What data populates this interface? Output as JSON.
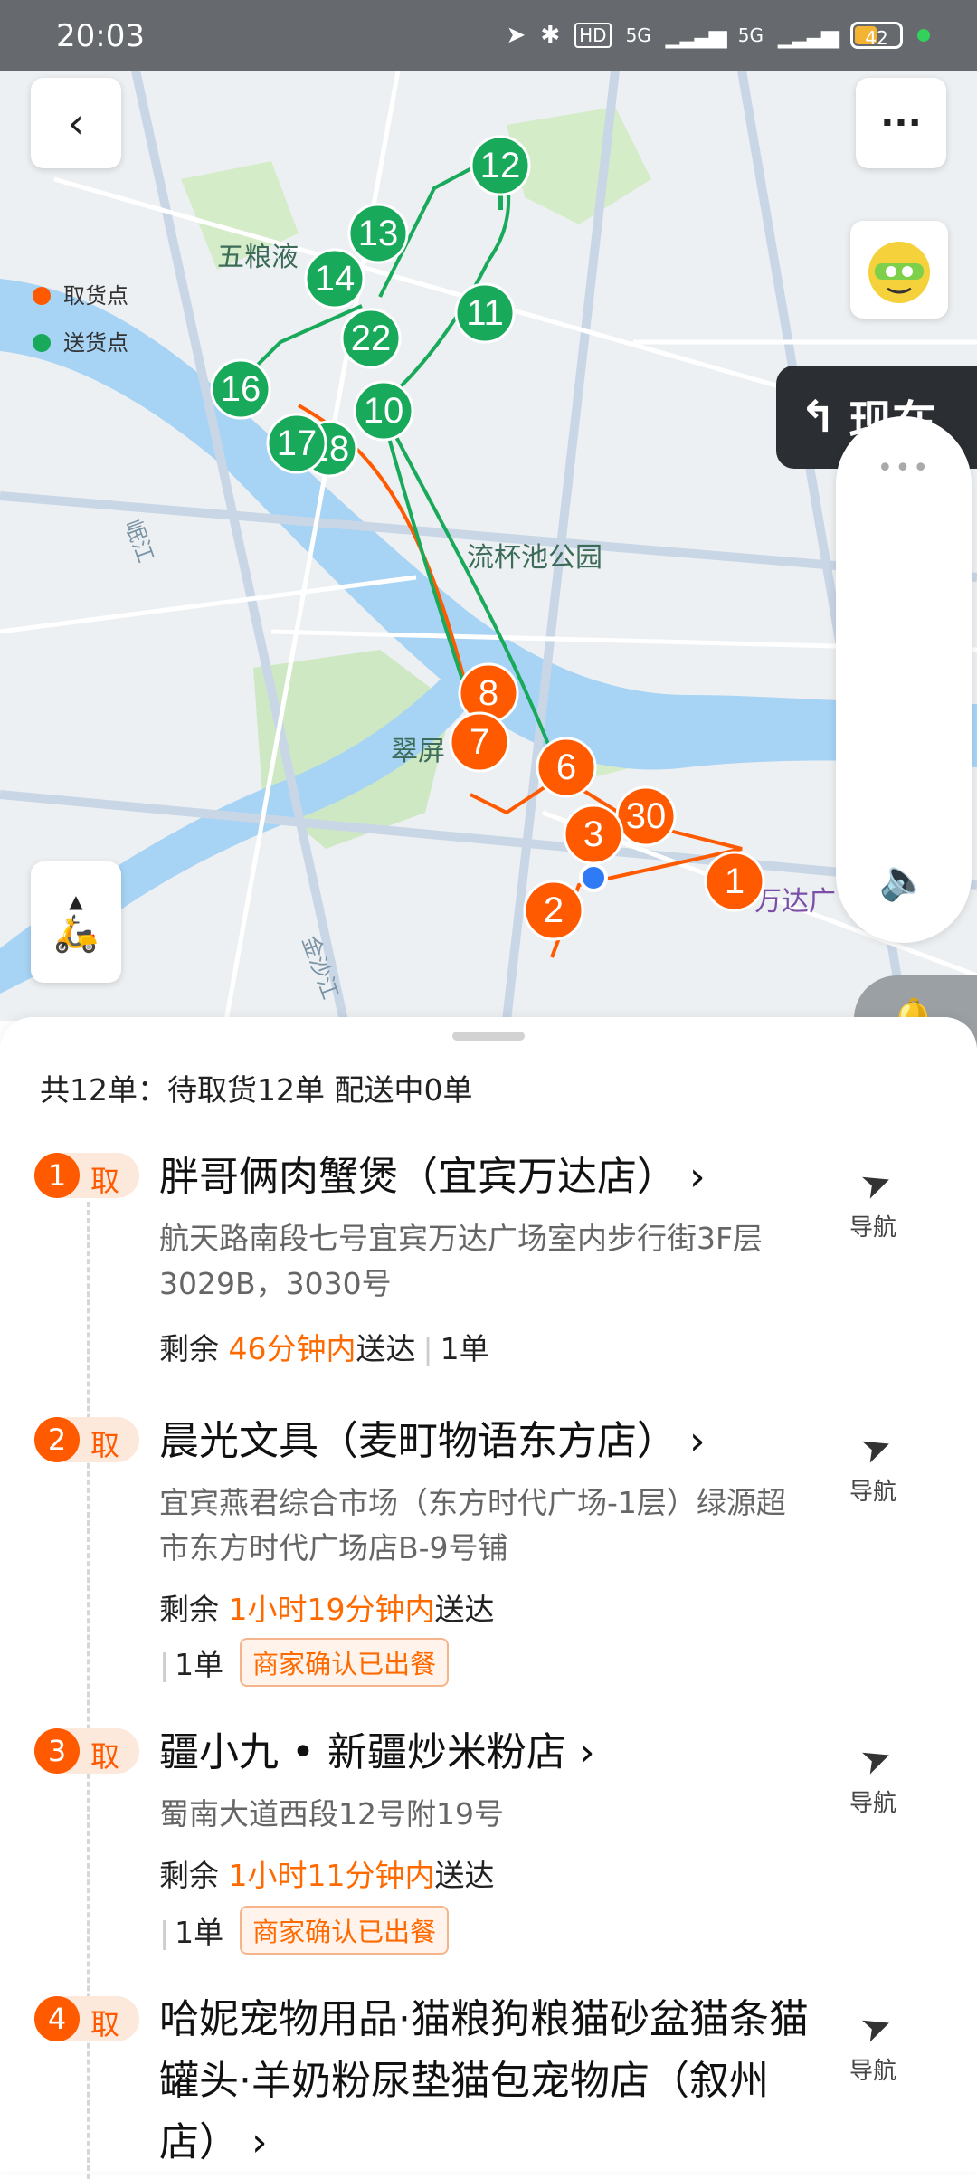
{
  "status_bar": {
    "time": "20:03",
    "network": "5G",
    "battery": "42"
  },
  "map": {
    "legend": [
      {
        "label": "取货点",
        "color": "#ff5a00"
      },
      {
        "label": "送货点",
        "color": "#19a95a"
      }
    ],
    "places": [
      "五粮液",
      "流杯池公园",
      "翠屏",
      "万达广"
    ],
    "rivers": [
      "岷江",
      "金沙江"
    ],
    "nav_banner": "现在",
    "pickup_pins": [
      "1",
      "2",
      "3",
      "6",
      "7",
      "8",
      "30"
    ],
    "delivery_pins": [
      "10",
      "11",
      "12",
      "13",
      "14",
      "16",
      "17",
      "18",
      "22"
    ]
  },
  "summary": "共12单：待取货12单 配送中0单",
  "orders": [
    {
      "index": "1",
      "kind": "取",
      "name": "胖哥俩肉蟹煲（宜宾万达店）",
      "address": "航天路南段七号宜宾万达广场室内步行街3F层3029B，3030号",
      "remain_prefix": "剩余",
      "remain_time": "46分钟内",
      "remain_suffix": "送达",
      "count": "1单",
      "tag": "",
      "nav": "导航"
    },
    {
      "index": "2",
      "kind": "取",
      "name": "晨光文具（麦町物语东方店）",
      "address": "宜宾燕君综合市场（东方时代广场-1层）绿源超市东方时代广场店B-9号铺",
      "remain_prefix": "剩余",
      "remain_time": "1小时19分钟内",
      "remain_suffix": "送达",
      "count": "1单",
      "tag": "商家确认已出餐",
      "nav": "导航"
    },
    {
      "index": "3",
      "kind": "取",
      "name": "疆小九 • 新疆炒米粉店",
      "address": "蜀南大道西段12号附19号",
      "remain_prefix": "剩余",
      "remain_time": "1小时11分钟内",
      "remain_suffix": "送达",
      "count": "1单",
      "tag": "商家确认已出餐",
      "nav": "导航"
    },
    {
      "index": "4",
      "kind": "取",
      "name": "哈妮宠物用品·猫粮狗粮猫砂盆猫条猫罐头·羊奶粉尿垫猫包宠物店（叙州店）",
      "nav": "导航"
    }
  ],
  "colors": {
    "pickup": "#ff5a00",
    "delivery": "#19a95a",
    "accent": "#ff6a00"
  }
}
